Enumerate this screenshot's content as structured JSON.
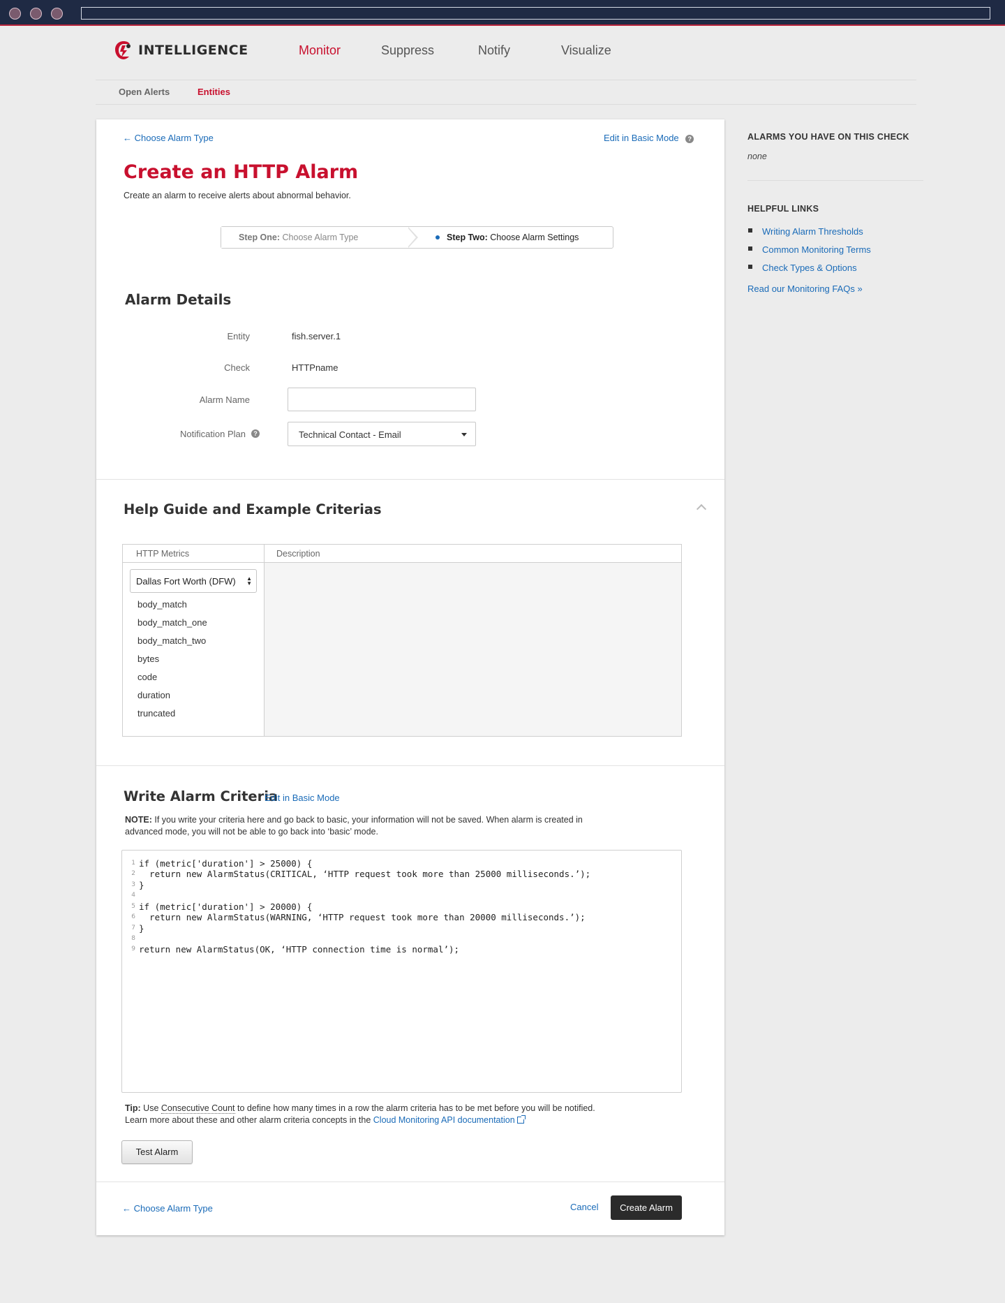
{
  "brand": {
    "name": "INTELLIGENCE",
    "accent": "#c8102e"
  },
  "main_nav": [
    {
      "label": "Monitor",
      "active": true
    },
    {
      "label": "Suppress",
      "active": false
    },
    {
      "label": "Notify",
      "active": false
    },
    {
      "label": "Visualize",
      "active": false
    }
  ],
  "sub_nav": [
    {
      "label": "Open Alerts",
      "active": false
    },
    {
      "label": "Entities",
      "active": true
    }
  ],
  "header": {
    "back_link": "← Choose Alarm Type",
    "edit_basic": "Edit in Basic Mode",
    "title": "Create an HTTP Alarm",
    "subtitle": "Create an alarm to receive alerts about abnormal behavior."
  },
  "steps": {
    "one_label": "Step One:",
    "one_text": "Choose Alarm Type",
    "two_label": "Step Two:",
    "two_text": "Choose Alarm Settings"
  },
  "alarm_details": {
    "title": "Alarm Details",
    "entity_label": "Entity",
    "entity_value": "fish.server.1",
    "check_label": "Check",
    "check_value": "HTTPname",
    "alarm_name_label": "Alarm Name",
    "alarm_name_value": "",
    "notification_label": "Notification Plan",
    "notification_value": "Technical Contact - Email"
  },
  "help_guide": {
    "title": "Help Guide and Example Criterias",
    "col_metrics": "HTTP Metrics",
    "col_description": "Description",
    "region": "Dallas Fort Worth (DFW)",
    "metrics": [
      "body_match",
      "body_match_one",
      "body_match_two",
      "bytes",
      "code",
      "duration",
      "truncated"
    ]
  },
  "criteria": {
    "title": "Write Alarm Criteria",
    "edit_basic": "Edit in Basic Mode",
    "note_label": "NOTE:",
    "note_text": " If you write your criteria here and go back to basic, your information will not be saved. When alarm is created in advanced mode, you will not be able to go back into ‘basic’ mode.",
    "code": [
      {
        "n": "1",
        "text": "if (metric['duration'] > 25000) {"
      },
      {
        "n": "2",
        "text": "  return new AlarmStatus(CRITICAL, ‘HTTP request took more than 25000 milliseconds.’);"
      },
      {
        "n": "3",
        "text": "}"
      },
      {
        "n": "4",
        "text": ""
      },
      {
        "n": "5",
        "text": "if (metric['duration'] > 20000) {"
      },
      {
        "n": "6",
        "text": "  return new AlarmStatus(WARNING, ‘HTTP request took more than 20000 milliseconds.’);"
      },
      {
        "n": "7",
        "text": "}"
      },
      {
        "n": "8",
        "text": ""
      },
      {
        "n": "9",
        "text": "return new AlarmStatus(OK, ‘HTTP connection time is normal’);"
      }
    ],
    "tip_label": "Tip:",
    "tip_pre": " Use ",
    "tip_term": "Consecutive Count",
    "tip_post": " to define how many times in a row the alarm criteria has to be met before you will be notified.",
    "tip_line2": "Learn more about these and other alarm criteria concepts in the ",
    "tip_link": "Cloud Monitoring API documentation",
    "test_button": "Test Alarm"
  },
  "footer": {
    "back_link": "← Choose Alarm Type",
    "cancel": "Cancel",
    "create": "Create Alarm"
  },
  "sidebar": {
    "alarms_title": "ALARMS YOU HAVE ON THIS CHECK",
    "alarms_value": "none",
    "links_title": "HELPFUL LINKS",
    "links": [
      "Writing Alarm Thresholds",
      "Common Monitoring Terms",
      "Check Types & Options"
    ],
    "faq": "Read our Monitoring FAQs »"
  }
}
